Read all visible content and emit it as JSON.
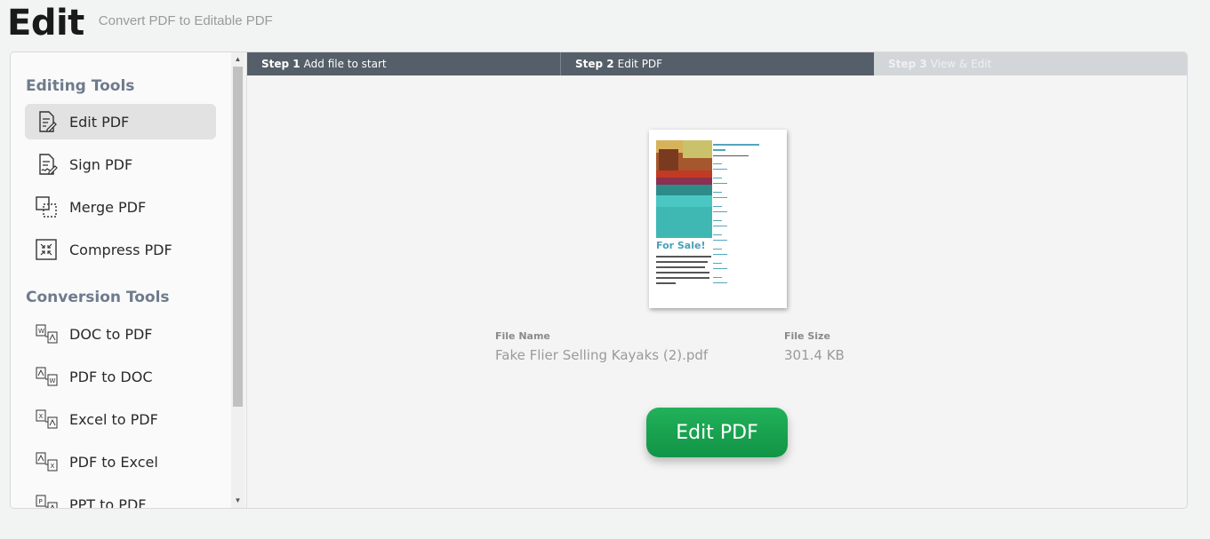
{
  "header": {
    "title": "Edit",
    "subtitle": "Convert PDF to Editable PDF"
  },
  "sidebar": {
    "sections": [
      {
        "title": "Editing Tools",
        "items": [
          {
            "label": "Edit PDF",
            "icon": "edit-pdf-icon",
            "active": true
          },
          {
            "label": "Sign PDF",
            "icon": "sign-pdf-icon"
          },
          {
            "label": "Merge PDF",
            "icon": "merge-pdf-icon"
          },
          {
            "label": "Compress PDF",
            "icon": "compress-pdf-icon"
          }
        ]
      },
      {
        "title": "Conversion Tools",
        "items": [
          {
            "label": "DOC to PDF",
            "icon": "doc-to-pdf-icon"
          },
          {
            "label": "PDF to DOC",
            "icon": "pdf-to-doc-icon"
          },
          {
            "label": "Excel to PDF",
            "icon": "excel-to-pdf-icon"
          },
          {
            "label": "PDF to Excel",
            "icon": "pdf-to-excel-icon"
          },
          {
            "label": "PPT to PDF",
            "icon": "ppt-to-pdf-icon"
          }
        ]
      }
    ]
  },
  "steps": [
    {
      "num": "Step 1",
      "label": "Add file to start",
      "state": "done"
    },
    {
      "num": "Step 2",
      "label": "Edit PDF",
      "state": "current"
    },
    {
      "num": "Step 3",
      "label": "View & Edit",
      "state": "todo"
    }
  ],
  "file": {
    "name_label": "File Name",
    "name": "Fake Flier Selling Kayaks (2).pdf",
    "size_label": "File Size",
    "size": "301.4 KB",
    "preview_heading": "For Sale!"
  },
  "actions": {
    "edit_button": "Edit PDF"
  },
  "colors": {
    "step_active": "#555f69",
    "step_inactive": "#d3d6d9",
    "button_green": "#1aa352",
    "section_title": "#6f7b8c"
  }
}
